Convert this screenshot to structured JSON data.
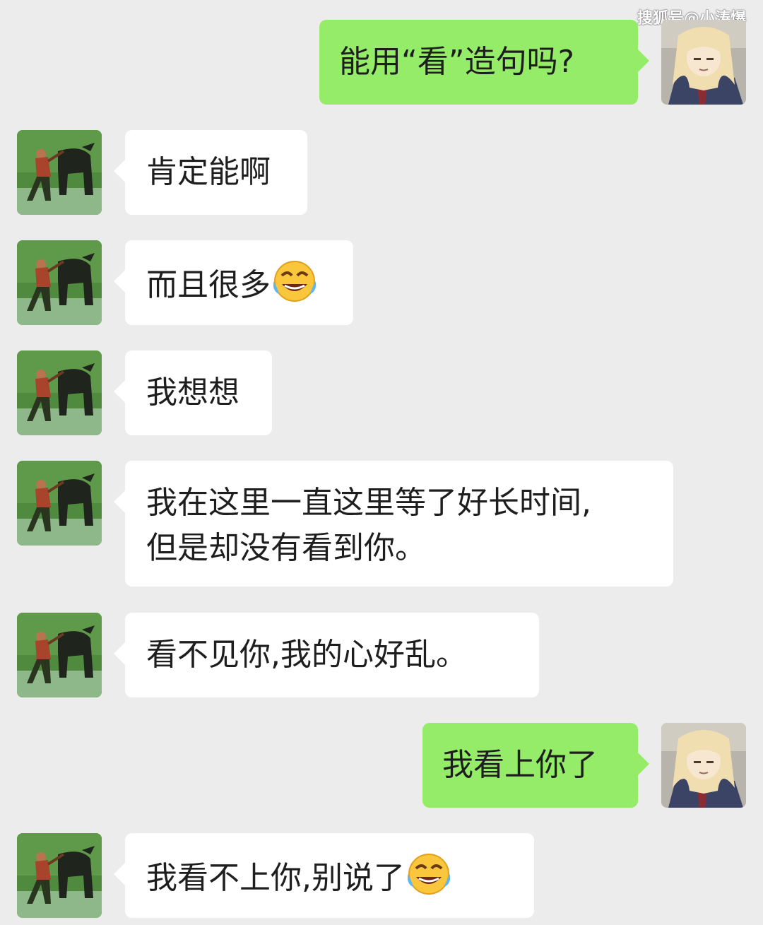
{
  "watermark": "搜狐号@小涛爆",
  "colors": {
    "background": "#ececec",
    "sent_bubble": "#95ec69",
    "received_bubble": "#ffffff",
    "text": "#1e1e1e"
  },
  "avatars": {
    "self": "anime-girl-avatar",
    "contact": "man-with-buffalo-avatar"
  },
  "messages": [
    {
      "sender": "self",
      "text": "能用“看”造句吗?"
    },
    {
      "sender": "contact",
      "text": "肯定能啊"
    },
    {
      "sender": "contact",
      "text": "而且很多",
      "emoji": "tears-of-joy-emoji"
    },
    {
      "sender": "contact",
      "text": "我想想"
    },
    {
      "sender": "contact",
      "lines": [
        "我在这里一直这里等了好长时间,",
        "但是却没有看到你。"
      ]
    },
    {
      "sender": "contact",
      "text": "看不见你,我的心好乱。"
    },
    {
      "sender": "self",
      "text": "我看上你了"
    },
    {
      "sender": "contact",
      "text": "我看不上你,别说了",
      "emoji": "tears-of-joy-emoji"
    }
  ]
}
